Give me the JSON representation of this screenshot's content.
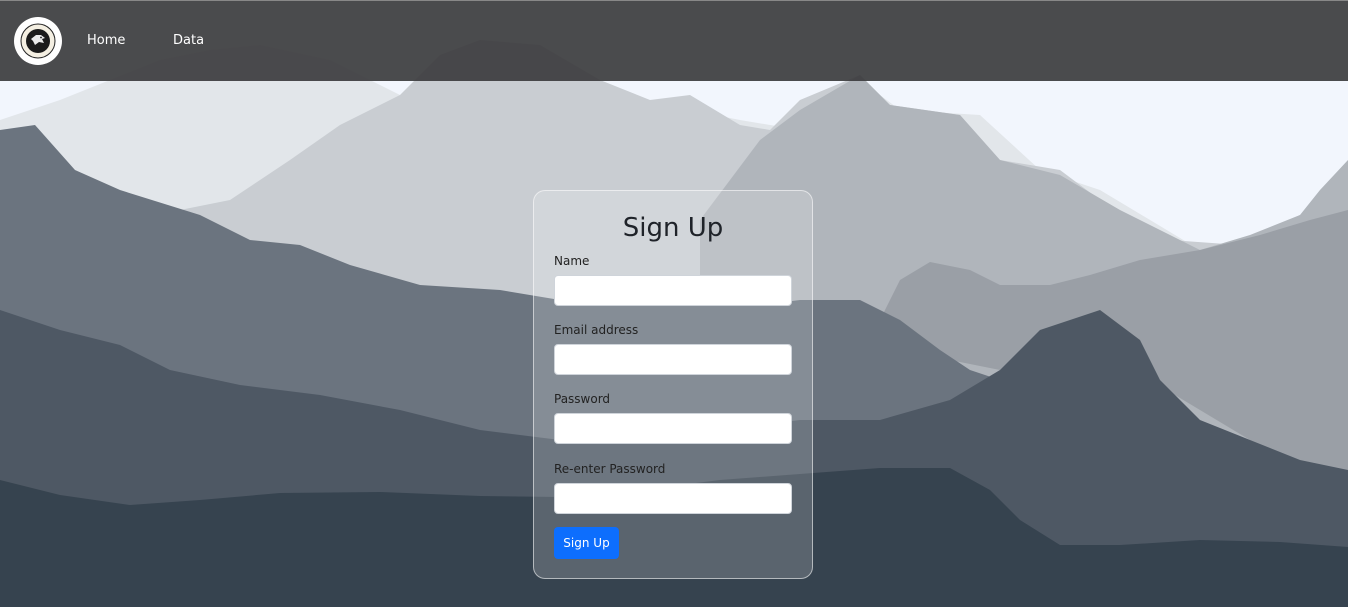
{
  "nav": {
    "home_label": "Home",
    "data_label": "Data",
    "logo_icon": "eagle-emblem-icon"
  },
  "form": {
    "title": "Sign Up",
    "name_label": "Name",
    "email_label": "Email address",
    "password_label": "Password",
    "reenter_label": "Re-enter Password",
    "name_value": "",
    "email_value": "",
    "password_value": "",
    "reenter_value": "",
    "submit_label": "Sign Up"
  },
  "colors": {
    "navbar": "#3c3c3e",
    "primary_button": "#0d6efd",
    "sky": "#f2f6fd",
    "mountain_far": "#e2e6ea",
    "mountain_mid_light": "#c9cdd2",
    "mountain_mid": "#b0b5bb",
    "mountain_mid_dark": "#9a9fa6",
    "mountain_dark": "#6b747f",
    "mountain_darker": "#4e5864",
    "mountain_darkest": "#36434f"
  }
}
